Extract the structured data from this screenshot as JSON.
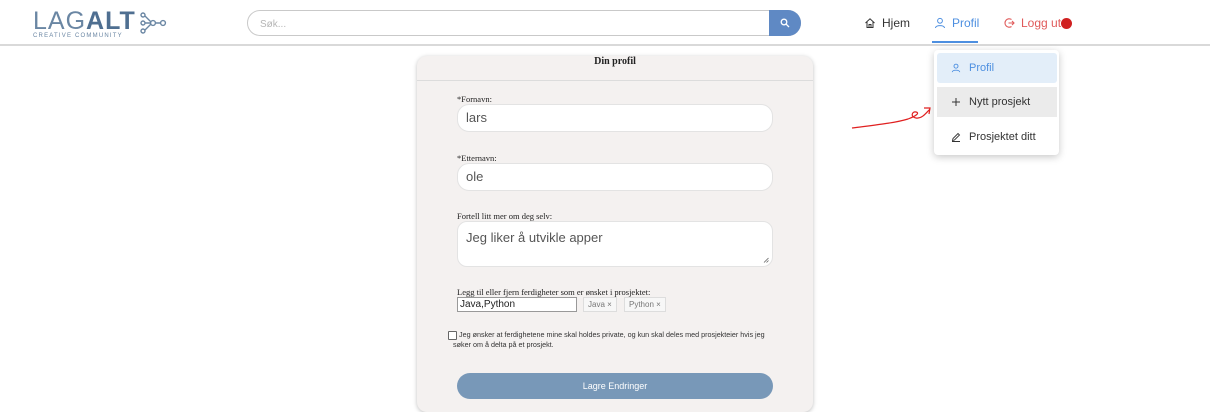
{
  "header": {
    "logo": {
      "main_light": "LAG",
      "main_bold": "ALT",
      "sub": "CREATIVE COMMUNITY"
    },
    "search": {
      "placeholder": "Søk..."
    },
    "nav": {
      "home_label": "Hjem",
      "profil_label": "Profil",
      "logout_label": "Logg ut"
    }
  },
  "dropdown": {
    "items": [
      {
        "label": "Profil",
        "icon": "user-icon"
      },
      {
        "label": "Nytt prosjekt",
        "icon": "plus-icon"
      },
      {
        "label": "Prosjektet ditt",
        "icon": "pencil-icon"
      }
    ]
  },
  "form": {
    "title": "Din profil",
    "firstname": {
      "label": "*Fornavn:",
      "value": "lars"
    },
    "lastname": {
      "label": "*Etternavn:",
      "value": "ole"
    },
    "about": {
      "label": "Fortell litt mer om deg selv:",
      "value": "Jeg liker å utvikle apper"
    },
    "skills": {
      "label": "Legg til eller fjern ferdigheter som er ønsket i prosjektet:",
      "value": "Java,Python",
      "chips": [
        "Java ×",
        "Python ×"
      ]
    },
    "privacy_text": "Jeg ønsker at ferdighetene mine skal holdes private, og kun skal deles med prosjekteier hvis jeg søker om å delta på et prosjekt.",
    "save_label": "Lagre Endringer"
  },
  "colors": {
    "accent": "#4d8fe0",
    "logout": "#e05a5a",
    "save_button": "#7898b8",
    "search_button": "#5f89c4",
    "annotation_arrow": "#e02020"
  }
}
